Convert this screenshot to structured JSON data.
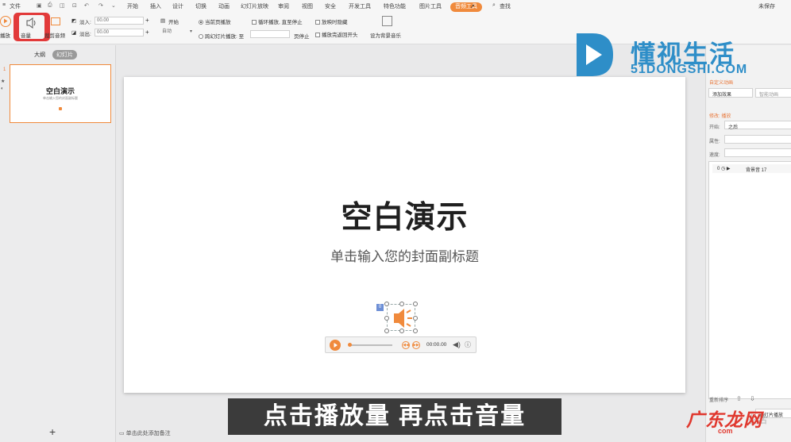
{
  "menubar": {
    "file": "文件",
    "tabs": [
      "开始",
      "插入",
      "设计",
      "切换",
      "动画",
      "幻灯片放映",
      "审阅",
      "视图",
      "安全",
      "开发工具",
      "特色功能",
      "图片工具",
      "音频工具"
    ],
    "search": "查找",
    "unsaved": "未保存"
  },
  "toolbar": {
    "play": "播放",
    "volume": "音量",
    "trim": "裁剪音频",
    "fade_in": "淡入:",
    "fade_in_value": "00.00",
    "fade_out": "淡出:",
    "fade_out_value": "00.00",
    "start": "开始",
    "start_value": "自动",
    "current_page": "当前页播放",
    "cross_pages": "跨幻灯片播放: 至",
    "page_stop": "页停止",
    "loop": "循环播放, 直至停止",
    "hide": "放映时隐藏",
    "rewind": "播放完返回开头",
    "set_bg": "设为背景音乐"
  },
  "leftpane": {
    "tab_outline": "大纲",
    "tab_slides": "幻灯片",
    "slide_number": "1",
    "add": "+"
  },
  "slide": {
    "title": "空白演示",
    "subtitle": "单击输入您的封面副标题",
    "audio_tag": "0",
    "time": "00:00.00"
  },
  "notes": "单击此处添加备注",
  "rightpane": {
    "header": "自定义动画",
    "add_effect": "添加效果",
    "smart": "智能动画",
    "modify": "修改: 播放",
    "start_label": "开始:",
    "start_value": "之后",
    "property": "属性:",
    "speed": "速度:",
    "item": "背景音 17",
    "reorder": "重新排序",
    "play_btn": "幻灯片播放"
  },
  "caption": "点击播放量 再点击音量",
  "watermark": {
    "name": "懂视生活",
    "url": "51DONGSHI.COM",
    "corner": "广东龙网",
    "corner_url": "com",
    "faint": "生活"
  },
  "colors": {
    "accent": "#f08a3c",
    "highlight_red": "#e23a3a",
    "brand_blue": "#2e8ec8"
  }
}
